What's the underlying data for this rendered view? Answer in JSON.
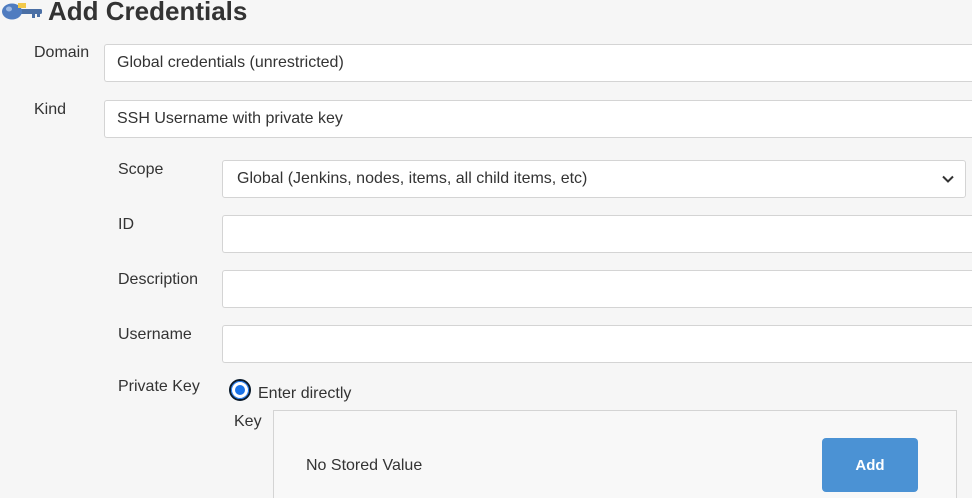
{
  "page": {
    "title": "Add Credentials"
  },
  "fields": {
    "domain": {
      "label": "Domain",
      "value": "Global credentials (unrestricted)"
    },
    "kind": {
      "label": "Kind",
      "value": "SSH Username with private key"
    },
    "scope": {
      "label": "Scope",
      "value": "Global (Jenkins, nodes, items, all child items, etc)"
    },
    "id": {
      "label": "ID",
      "value": ""
    },
    "description": {
      "label": "Description",
      "value": ""
    },
    "username": {
      "label": "Username",
      "value": ""
    },
    "private_key": {
      "label": "Private Key",
      "option_label": "Enter directly",
      "option_selected": true,
      "key_label": "Key",
      "stored_status": "No Stored Value",
      "add_label": "Add"
    }
  },
  "colors": {
    "accent": "#4b92d4",
    "radio": "#1a73e8",
    "background": "#f6f6f6"
  },
  "icons": {
    "title": "key-icon",
    "select": "chevron-down-icon"
  }
}
